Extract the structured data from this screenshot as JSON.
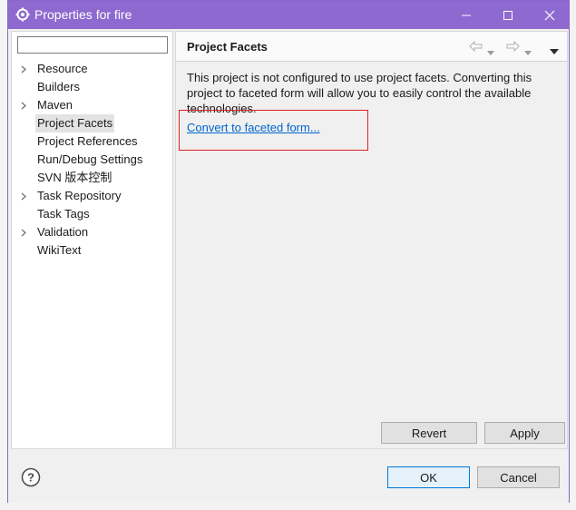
{
  "window": {
    "title": "Properties for fire"
  },
  "filter": {
    "value": "",
    "placeholder": ""
  },
  "tree": {
    "items": [
      {
        "label": "Resource",
        "expandable": true,
        "selected": false
      },
      {
        "label": "Builders",
        "expandable": false,
        "selected": false
      },
      {
        "label": "Maven",
        "expandable": true,
        "selected": false
      },
      {
        "label": "Project Facets",
        "expandable": false,
        "selected": true
      },
      {
        "label": "Project References",
        "expandable": false,
        "selected": false
      },
      {
        "label": "Run/Debug Settings",
        "expandable": false,
        "selected": false
      },
      {
        "label": "SVN 版本控制",
        "expandable": false,
        "selected": false
      },
      {
        "label": "Task Repository",
        "expandable": true,
        "selected": false
      },
      {
        "label": "Task Tags",
        "expandable": false,
        "selected": false
      },
      {
        "label": "Validation",
        "expandable": true,
        "selected": false
      },
      {
        "label": "WikiText",
        "expandable": false,
        "selected": false
      }
    ]
  },
  "page": {
    "title": "Project Facets",
    "description": "This project is not configured to use project facets. Converting this project to faceted form will allow you to easily control the available technologies.",
    "convert_link": "Convert to faceted form...",
    "revert_label": "Revert",
    "apply_label": "Apply"
  },
  "footer": {
    "ok_label": "OK",
    "cancel_label": "Cancel"
  },
  "colors": {
    "titlebar": "#8e6ad0",
    "link": "#0066cc",
    "highlight_box": "#e02020"
  }
}
